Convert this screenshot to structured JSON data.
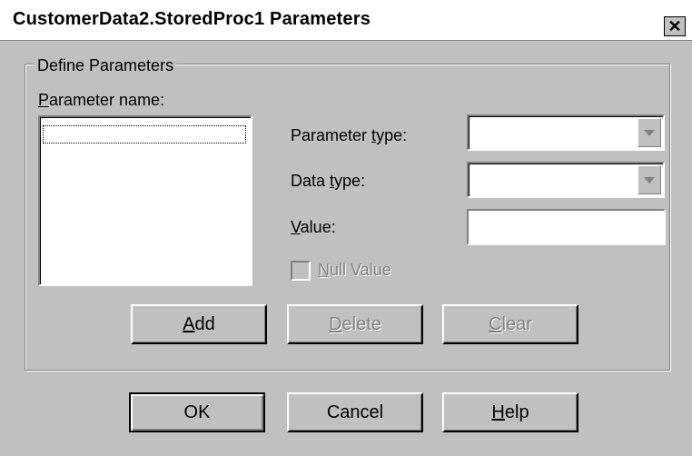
{
  "window": {
    "title": "CustomerData2.StoredProc1 Parameters",
    "close_glyph": "✕"
  },
  "group": {
    "legend": "Define Parameters"
  },
  "parameter_name": {
    "label_mnemonic": "P",
    "label_rest": "arameter name:",
    "items": []
  },
  "parameter_type": {
    "label_pre": "Parameter ",
    "label_mnemonic": "t",
    "label_post": "ype:",
    "value": ""
  },
  "data_type": {
    "label_pre": "Data ",
    "label_mnemonic": "t",
    "label_post": "ype:",
    "value": ""
  },
  "value_field": {
    "label_mnemonic": "V",
    "label_rest": "alue:",
    "value": ""
  },
  "null_value": {
    "label_mnemonic": "N",
    "label_rest": "ull Value",
    "checked": false,
    "enabled": false
  },
  "actions": {
    "add_mnemonic": "A",
    "add_rest": "dd",
    "delete_mnemonic": "D",
    "delete_rest": "elete",
    "clear_mnemonic": "C",
    "clear_rest": "lear"
  },
  "footer": {
    "ok": "OK",
    "cancel": "Cancel",
    "help_mnemonic": "H",
    "help_rest": "elp"
  },
  "icons": {
    "dropdown": "chevron-down-icon",
    "close": "close-icon"
  },
  "colors": {
    "face": "#c0c0c0",
    "disabled_text": "#808080"
  }
}
